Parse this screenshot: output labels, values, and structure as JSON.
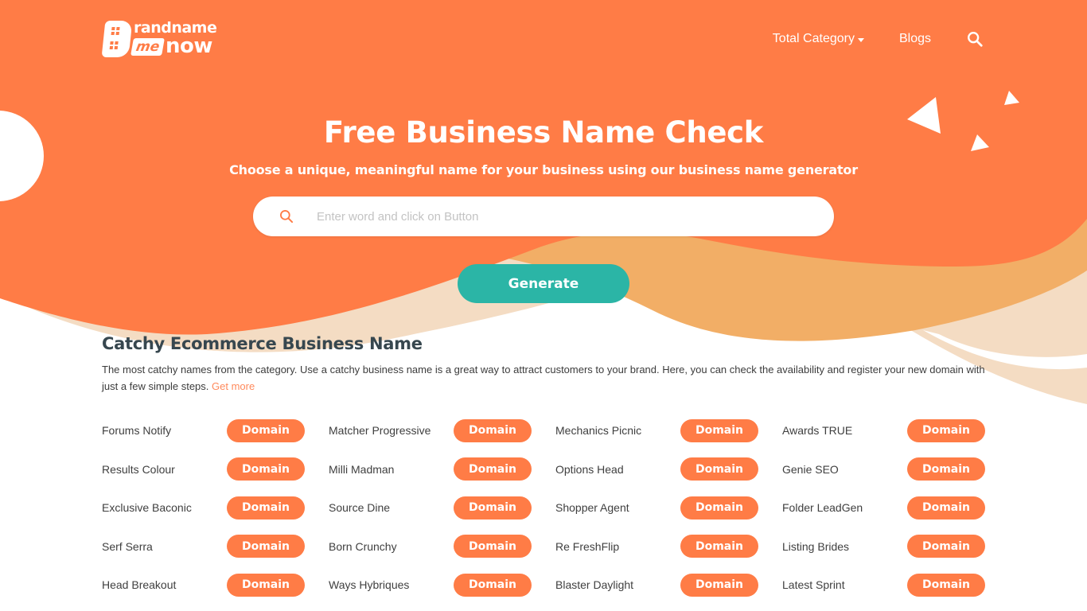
{
  "colors": {
    "brand_orange": "#ff7c46",
    "light_orange": "#f2ae66",
    "peach": "#f4dcc3",
    "teal": "#2bb5a6",
    "link": "#ff8a5c"
  },
  "header": {
    "logo": {
      "line1": "randname",
      "me": "me",
      "line2": "now",
      "alt": "Brandname me now"
    },
    "nav": [
      {
        "label": "Total Category",
        "icon": "caret-down-icon"
      },
      {
        "label": "Blogs"
      }
    ],
    "search_icon": "search-icon"
  },
  "hero": {
    "title": "Free Business Name Check",
    "subtitle": "Choose a unique, meaningful name for your business using our business name generator",
    "search": {
      "placeholder": "Enter word and click on Button",
      "value": "",
      "icon": "search-icon"
    },
    "generate_label": "Generate"
  },
  "section": {
    "title": "Catchy Ecommerce Business Name",
    "description": "The most catchy names from the category. Use a catchy business name is a great way to attract customers to your brand. Here, you can check the availability and register your new domain with just a few simple steps.",
    "get_more": "Get more"
  },
  "names": [
    {
      "name": "Forums Notify",
      "button": "Domain"
    },
    {
      "name": "Matcher Progressive",
      "button": "Domain"
    },
    {
      "name": "Mechanics Picnic",
      "button": "Domain"
    },
    {
      "name": "Awards TRUE",
      "button": "Domain"
    },
    {
      "name": "Results Colour",
      "button": "Domain"
    },
    {
      "name": "Milli Madman",
      "button": "Domain"
    },
    {
      "name": "Options Head",
      "button": "Domain"
    },
    {
      "name": "Genie SEO",
      "button": "Domain"
    },
    {
      "name": "Exclusive Baconic",
      "button": "Domain"
    },
    {
      "name": "Source Dine",
      "button": "Domain"
    },
    {
      "name": "Shopper Agent",
      "button": "Domain"
    },
    {
      "name": "Folder LeadGen",
      "button": "Domain"
    },
    {
      "name": "Serf Serra",
      "button": "Domain"
    },
    {
      "name": "Born Crunchy",
      "button": "Domain"
    },
    {
      "name": "Re FreshFlip",
      "button": "Domain"
    },
    {
      "name": "Listing Brides",
      "button": "Domain"
    },
    {
      "name": "Head Breakout",
      "button": "Domain"
    },
    {
      "name": "Ways Hybriques",
      "button": "Domain"
    },
    {
      "name": "Blaster Daylight",
      "button": "Domain"
    },
    {
      "name": "Latest Sprint",
      "button": "Domain"
    }
  ]
}
